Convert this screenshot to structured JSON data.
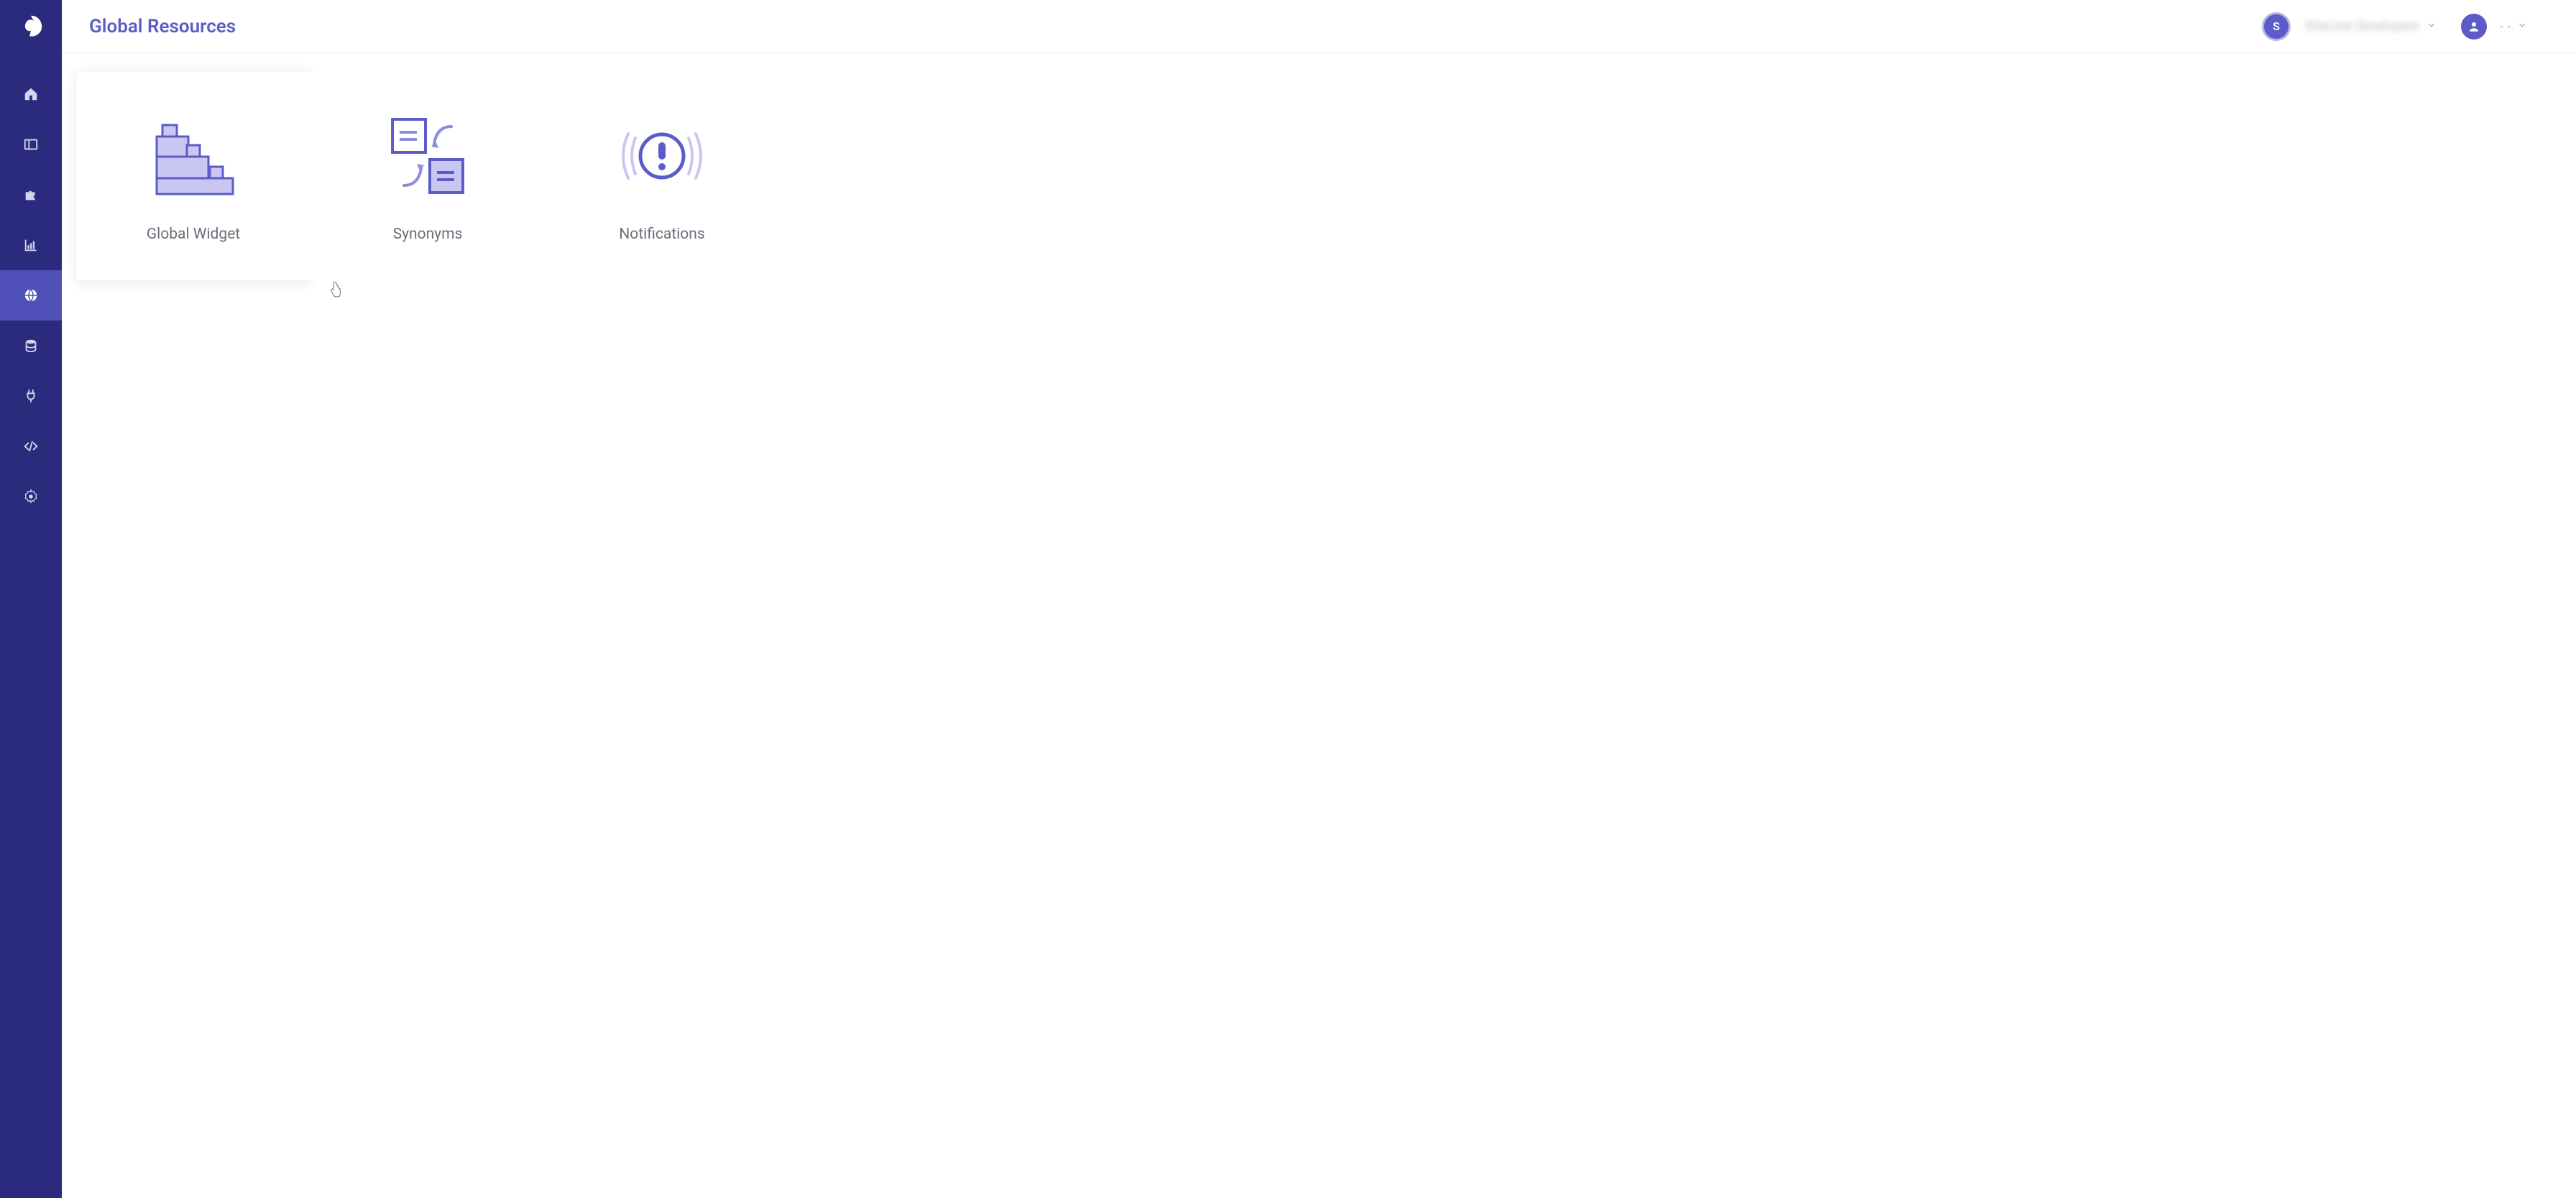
{
  "header": {
    "title": "Global Resources",
    "avatar_initial": "S",
    "org_name": "Sitecore Developers",
    "user_menu_label": "- -"
  },
  "sidebar": {
    "items": [
      {
        "name": "home"
      },
      {
        "name": "layout"
      },
      {
        "name": "plugin"
      },
      {
        "name": "analytics"
      },
      {
        "name": "global",
        "active": true
      },
      {
        "name": "database"
      },
      {
        "name": "connector"
      },
      {
        "name": "code"
      },
      {
        "name": "settings"
      }
    ]
  },
  "cards": [
    {
      "label": "Global Widget",
      "hovered": true
    },
    {
      "label": "Synonyms"
    },
    {
      "label": "Notifications"
    }
  ],
  "colors": {
    "sidebar_bg": "#2a2b7d",
    "sidebar_active": "#4f50b8",
    "accent": "#5b5cc7",
    "icon_fill": "#c9c7f2",
    "icon_stroke": "#5b5cc7"
  }
}
